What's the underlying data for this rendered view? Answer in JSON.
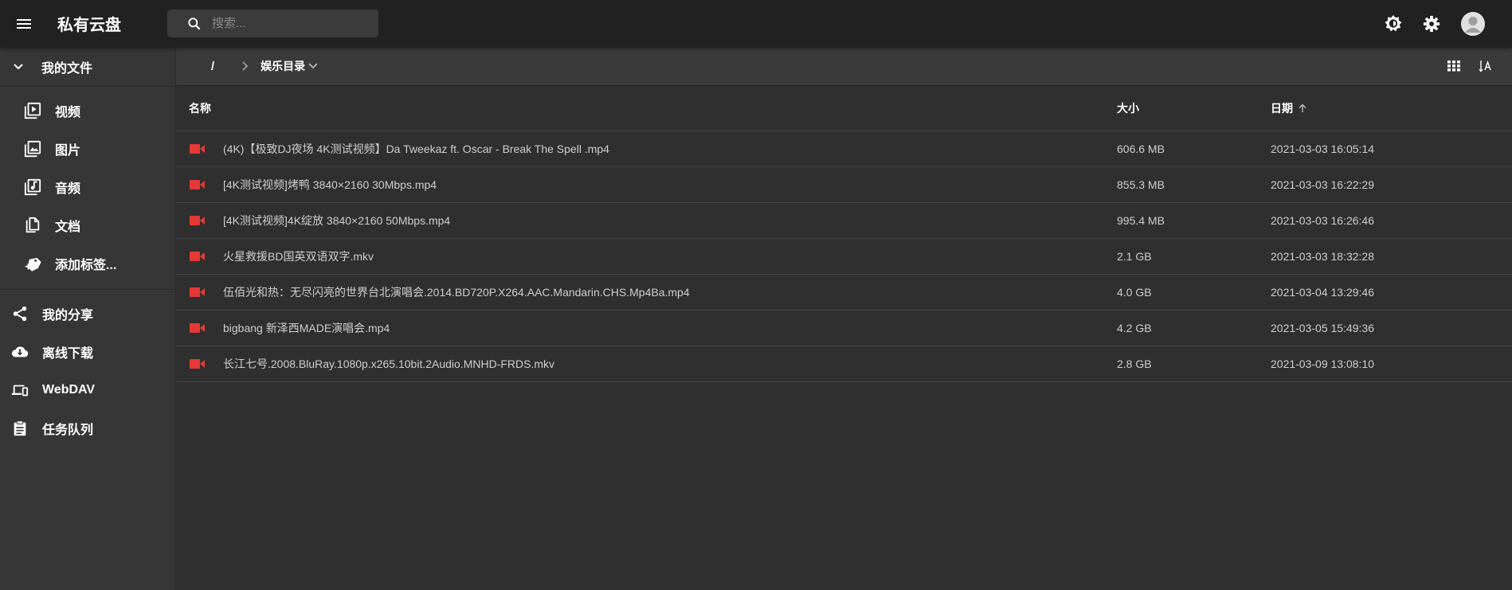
{
  "app": {
    "title": "私有云盘"
  },
  "search": {
    "placeholder": "搜索..."
  },
  "sidebar": {
    "my_files": "我的文件",
    "sub_items": [
      {
        "label": "视频",
        "icon": "video-library-icon"
      },
      {
        "label": "图片",
        "icon": "image-library-icon"
      },
      {
        "label": "音频",
        "icon": "music-library-icon"
      },
      {
        "label": "文档",
        "icon": "documents-icon"
      },
      {
        "label": "添加标签...",
        "icon": "add-tag-icon"
      }
    ],
    "items": [
      {
        "label": "我的分享",
        "icon": "share-icon"
      },
      {
        "label": "离线下载",
        "icon": "cloud-download-icon"
      },
      {
        "label": "WebDAV",
        "icon": "devices-icon"
      },
      {
        "label": "任务队列",
        "icon": "task-queue-icon"
      }
    ]
  },
  "breadcrumb": {
    "root": "/",
    "current": "娱乐目录"
  },
  "table": {
    "headers": {
      "name": "名称",
      "size": "大小",
      "date": "日期"
    },
    "sort": {
      "column": "date",
      "direction": "ascending"
    },
    "rows": [
      {
        "name": "(4K)【极致DJ夜场 4K测试视频】Da Tweekaz ft. Oscar - Break The Spell .mp4",
        "size": "606.6 MB",
        "date": "2021-03-03 16:05:14"
      },
      {
        "name": "[4K测试视频]烤鸭 3840×2160 30Mbps.mp4",
        "size": "855.3 MB",
        "date": "2021-03-03 16:22:29"
      },
      {
        "name": "[4K测试视频]4K绽放 3840×2160 50Mbps.mp4",
        "size": "995.4 MB",
        "date": "2021-03-03 16:26:46"
      },
      {
        "name": "火星救援BD国英双语双字.mkv",
        "size": "2.1 GB",
        "date": "2021-03-03 18:32:28"
      },
      {
        "name": "伍佰光和热：无尽闪亮的世界台北演唱会.2014.BD720P.X264.AAC.Mandarin.CHS.Mp4Ba.mp4",
        "size": "4.0 GB",
        "date": "2021-03-04 13:29:46"
      },
      {
        "name": "bigbang 新泽西MADE演唱会.mp4",
        "size": "4.2 GB",
        "date": "2021-03-05 15:49:36"
      },
      {
        "name": "长江七号.2008.BluRay.1080p.x265.10bit.2Audio.MNHD-FRDS.mkv",
        "size": "2.8 GB",
        "date": "2021-03-09 13:08:10"
      }
    ]
  },
  "colors": {
    "accent": "#e53935",
    "appbar": "#212121",
    "sidebar": "#363636",
    "content": "#2f2f2f"
  }
}
